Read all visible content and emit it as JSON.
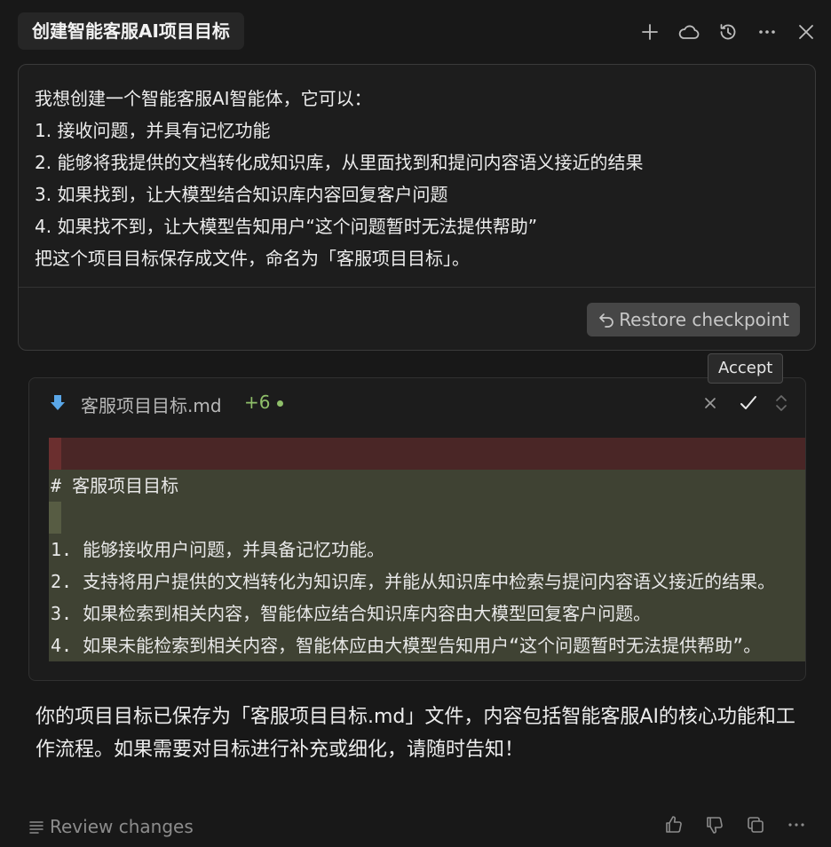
{
  "header": {
    "title": "创建智能客服AI项目目标",
    "icons": [
      "plus-icon",
      "cloud-icon",
      "history-icon",
      "more-icon",
      "close-icon"
    ]
  },
  "user_message": {
    "lines": [
      "我想创建一个智能客服AI智能体，它可以：",
      "1. 接收问题，并具有记忆功能",
      "2. 能够将我提供的文档转化成知识库，从里面找到和提问内容语义接近的结果",
      "3. 如果找到，让大模型结合知识库内容回复客户问题",
      "4. 如果找不到，让大模型告知用户“这个问题暂时无法提供帮助”",
      "把这个项目目标保存成文件，命名为「客服项目目标」。"
    ],
    "restore_label": "Restore checkpoint"
  },
  "tooltip": {
    "text": "Accept"
  },
  "diff": {
    "file_name": "客服项目目标.md",
    "added_count": "+6",
    "lines": [
      {
        "type": "removed",
        "text": ""
      },
      {
        "type": "added",
        "text": "# 客服项目目标"
      },
      {
        "type": "added",
        "text": ""
      },
      {
        "type": "added",
        "text": "1. 能够接收用户问题，并具备记忆功能。"
      },
      {
        "type": "added",
        "text": "2. 支持将用户提供的文档转化为知识库，并能从知识库中检索与提问内容语义接近的结果。"
      },
      {
        "type": "added",
        "text": "3. 如果检索到相关内容，智能体应结合知识库内容由大模型回复客户问题。"
      },
      {
        "type": "added",
        "text": "4. 如果未能检索到相关内容，智能体应由大模型告知用户“这个问题暂时无法提供帮助”。"
      }
    ]
  },
  "assistant_message": {
    "text": "你的项目目标已保存为「客服项目目标.md」文件，内容包括智能客服AI的核心功能和工作流程。如果需要对目标进行补充或细化，请随时告知！"
  },
  "footer": {
    "review_label": "Review changes",
    "icons": [
      "thumbs-up-icon",
      "thumbs-down-icon",
      "copy-icon",
      "more-icon"
    ]
  }
}
